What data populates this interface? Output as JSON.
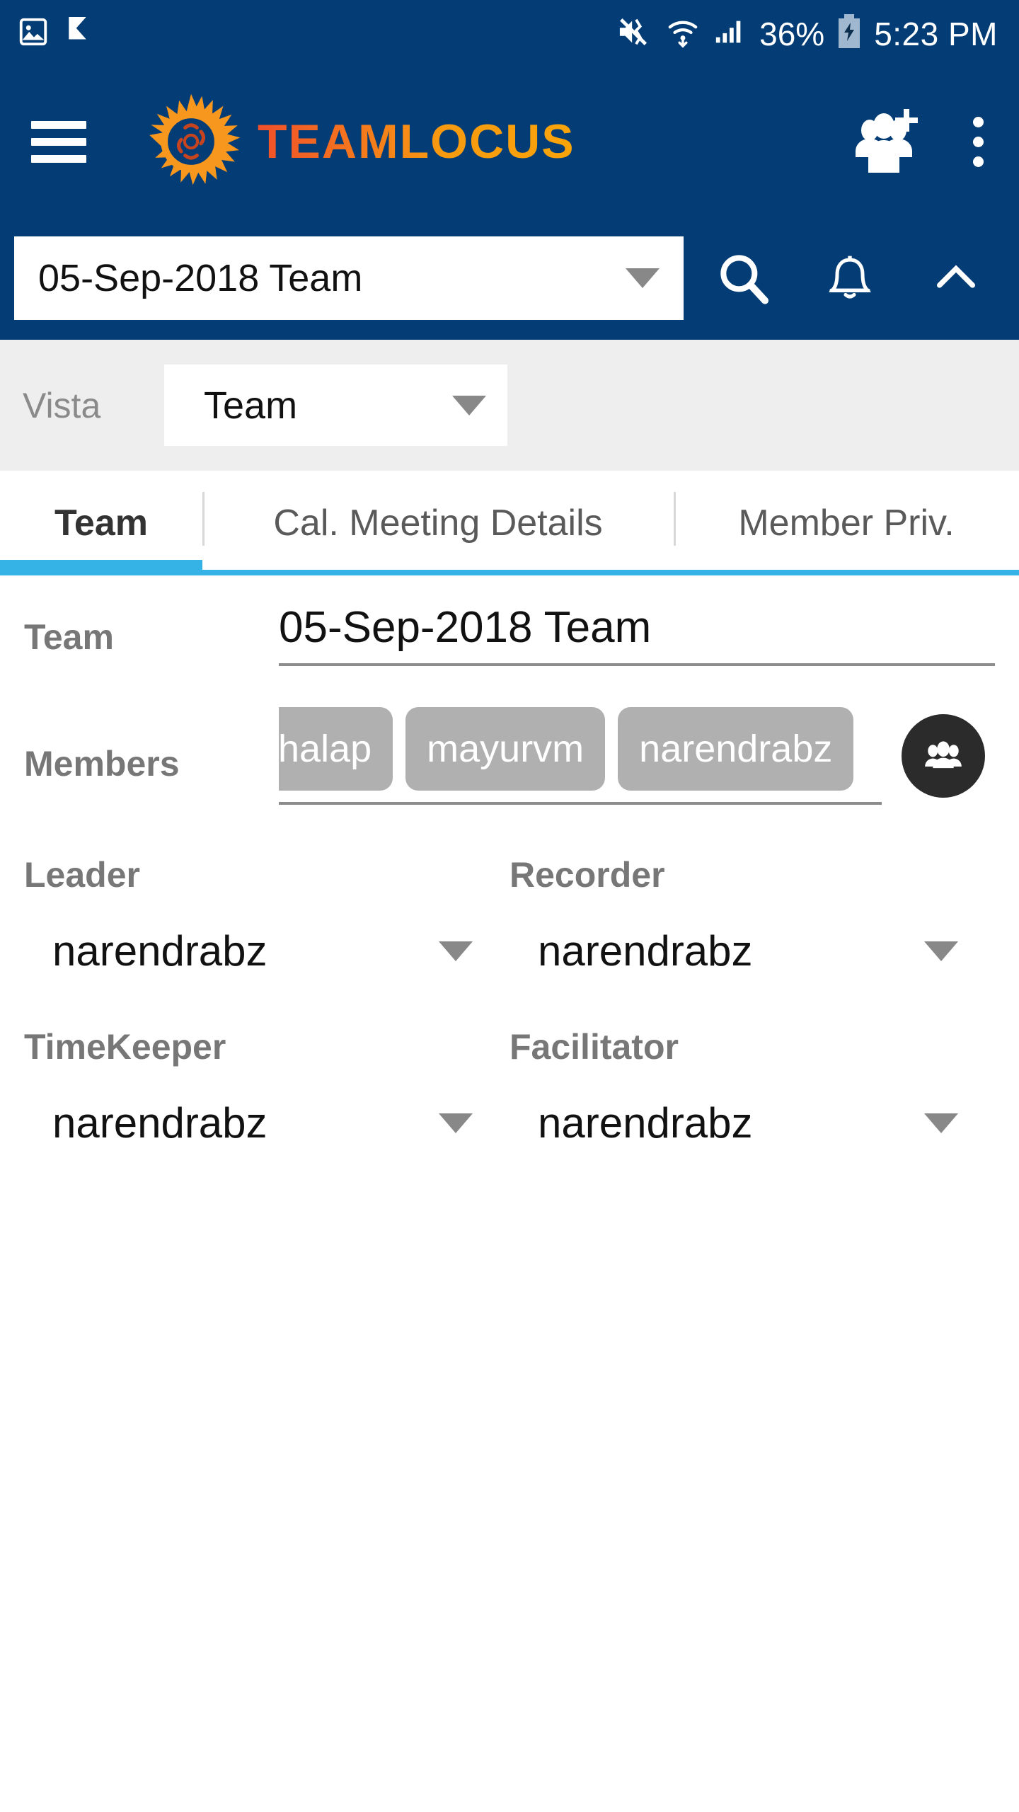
{
  "status_bar": {
    "icons_left": [
      "image-icon",
      "checkmark-flag-icon"
    ],
    "icons_right": [
      "mute-vibrate-icon",
      "wifi-icon",
      "signal-bars-icon",
      "battery-charging-icon"
    ],
    "battery_percent": "36%",
    "time": "5:23 PM"
  },
  "app_bar": {
    "menu_icon": "hamburger-menu-icon",
    "logo_icon": "sun-logo-icon",
    "brand": "TEAMLOCUS",
    "add_members_icon": "add-people-icon",
    "overflow_icon": "kebab-menu-icon"
  },
  "search_row": {
    "team_selected": "05-Sep-2018 Team",
    "search_icon": "search-icon",
    "notifications_icon": "bell-icon",
    "collapse_icon": "chevron-up-icon"
  },
  "vista": {
    "label": "Vista",
    "selected": "Team"
  },
  "tabs": [
    {
      "label": "Team",
      "active": true
    },
    {
      "label": "Cal. Meeting Details",
      "active": false
    },
    {
      "label": "Member Priv.",
      "active": false
    }
  ],
  "form": {
    "team_label": "Team",
    "team_value": "05-Sep-2018 Team",
    "members_label": "Members",
    "members": [
      "shalap",
      "mayurvm",
      "narendrabz"
    ],
    "members_picker_icon": "people-group-icon",
    "roles": [
      {
        "label": "Leader",
        "value": "narendrabz"
      },
      {
        "label": "Recorder",
        "value": "narendrabz"
      },
      {
        "label": "TimeKeeper",
        "value": "narendrabz"
      },
      {
        "label": "Facilitator",
        "value": "narendrabz"
      }
    ]
  },
  "colors": {
    "header_blue": "#043d75",
    "accent_cyan": "#35b3e6",
    "chip_gray": "#b0b0b0",
    "vista_bg": "#eeeeee",
    "brand_orange": "#f79a10"
  }
}
